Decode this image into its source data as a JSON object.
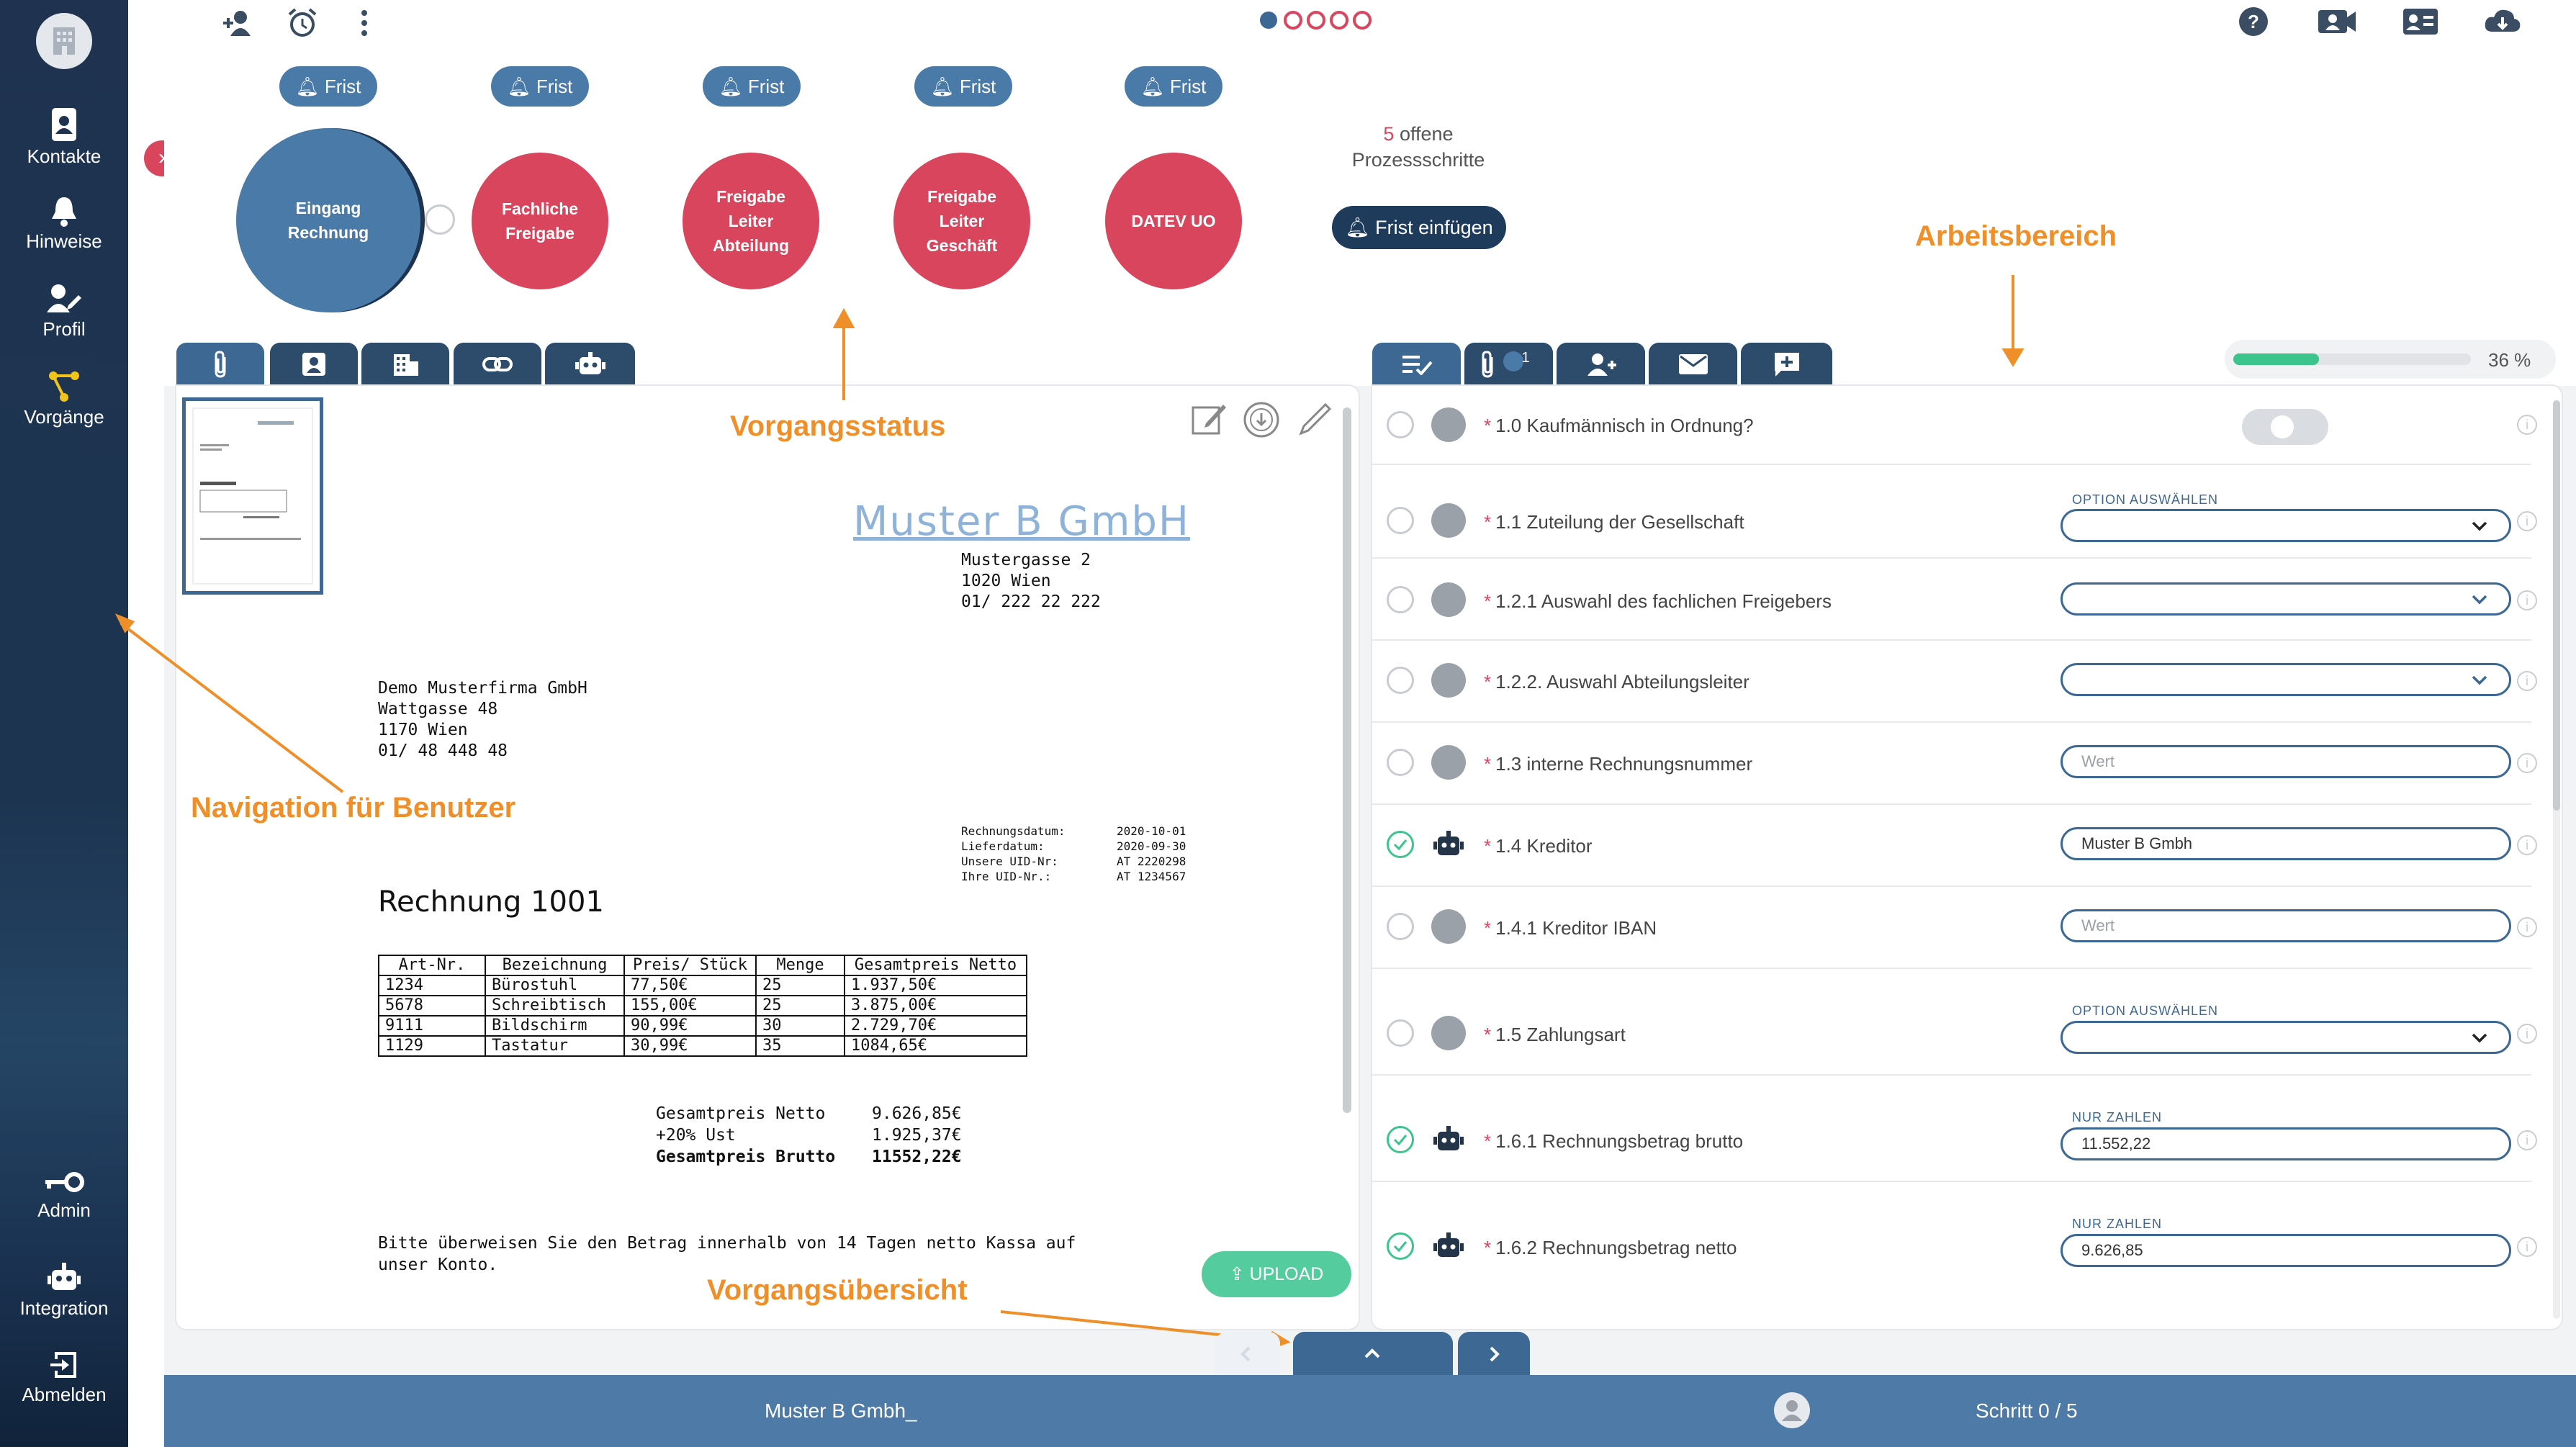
{
  "sidebar": {
    "items": [
      {
        "label": "Kontakte",
        "icon": "contacts-icon"
      },
      {
        "label": "Hinweise",
        "icon": "bell-icon"
      },
      {
        "label": "Profil",
        "icon": "user-edit-icon"
      },
      {
        "label": "Vorgänge",
        "icon": "workflow-icon"
      }
    ],
    "bottom_items": [
      {
        "label": "Admin",
        "icon": "key-icon"
      },
      {
        "label": "Integration",
        "icon": "robot-icon"
      },
      {
        "label": "Abmelden",
        "icon": "logout-icon"
      }
    ]
  },
  "stages": {
    "frist_label": "Frist",
    "items": [
      {
        "label": "Eingang Rechnung",
        "active": true
      },
      {
        "label": "Fachliche Freigabe"
      },
      {
        "label": "Freigabe Leiter Abteilung"
      },
      {
        "label": "Freigabe Leiter Geschäft"
      },
      {
        "label": "DATEV UO"
      }
    ],
    "open_count": "5",
    "open_text": "offene",
    "open_text2": "Prozessschritte",
    "insert_button": "Frist einfügen"
  },
  "annotations": {
    "arbeitsbereich": "Arbeitsbereich",
    "vorgangsstatus": "Vorgangsstatus",
    "navigation": "Navigation für Benutzer",
    "uebersicht": "Vorgangsübersicht"
  },
  "invoice": {
    "company": "Muster B GmbH",
    "address": [
      "Mustergasse 2",
      "1020 Wien",
      "01/ 222 22 222"
    ],
    "recipient": [
      "Demo Musterfirma GmbH",
      "Wattgasse 48",
      "1170 Wien",
      "01/ 48 448 48"
    ],
    "meta_labels": [
      "Rechnungsdatum:",
      "Lieferdatum:",
      "Unsere UID-Nr:",
      "Ihre UID-Nr.:"
    ],
    "meta_values": [
      "2020-10-01",
      "2020-09-30",
      "AT 2220298",
      "AT 1234567"
    ],
    "title": "Rechnung 1001",
    "headers": [
      "Art-Nr.",
      "Bezeichnung",
      "Preis/ Stück",
      "Menge",
      "Gesamtpreis Netto"
    ],
    "rows": [
      [
        "1234",
        "Bürostuhl",
        "77,50€",
        "25",
        "1.937,50€"
      ],
      [
        "5678",
        "Schreibtisch",
        "155,00€",
        "25",
        "3.875,00€"
      ],
      [
        "9111",
        "Bildschirm",
        "90,99€",
        "30",
        "2.729,70€"
      ],
      [
        "1129",
        "Tastatur",
        "30,99€",
        "35",
        "1084,65€"
      ]
    ],
    "totals_labels": [
      "Gesamtpreis Netto",
      "+20% Ust",
      "Gesamtpreis Brutto"
    ],
    "totals_values": [
      "9.626,85€",
      "1.925,37€",
      "11552,22€"
    ],
    "footer": "Bitte überweisen Sie den Betrag innerhalb von 14 Tagen netto Kassa auf unser Konto.",
    "upload": "UPLOAD"
  },
  "workarea": {
    "progress_label": "36 %",
    "progress_value": 0.36,
    "attachment_badge": "1",
    "rows": [
      {
        "q": "1.0 Kaufmännisch in Ordnung?",
        "type": "toggle",
        "done": false,
        "who": "user"
      },
      {
        "q": "1.1 Zuteilung der Gesellschaft",
        "type": "select",
        "label": "OPTION AUSWÄHLEN",
        "done": false,
        "who": "user"
      },
      {
        "q": "1.2.1 Auswahl des fachlichen Freigebers",
        "type": "select",
        "done": false,
        "who": "user"
      },
      {
        "q": "1.2.2. Auswahl Abteilungsleiter",
        "type": "select",
        "done": false,
        "who": "user"
      },
      {
        "q": "1.3 interne Rechnungsnummer",
        "type": "text",
        "placeholder": "Wert",
        "done": false,
        "who": "user"
      },
      {
        "q": "1.4 Kreditor",
        "type": "text",
        "value": "Muster B Gmbh",
        "done": true,
        "who": "bot"
      },
      {
        "q": "1.4.1 Kreditor IBAN",
        "type": "text",
        "placeholder": "Wert",
        "done": false,
        "who": "user"
      },
      {
        "q": "1.5 Zahlungsart",
        "type": "select",
        "label": "OPTION AUSWÄHLEN",
        "done": false,
        "who": "user"
      },
      {
        "q": "1.6.1 Rechnungsbetrag brutto",
        "type": "text",
        "label": "NUR ZAHLEN",
        "value": "11.552,22",
        "done": true,
        "who": "bot"
      },
      {
        "q": "1.6.2 Rechnungsbetrag netto",
        "type": "text",
        "label": "NUR ZAHLEN",
        "value": "9.626,85",
        "done": true,
        "who": "bot"
      }
    ]
  },
  "bottombar": {
    "name": "Muster B Gmbh_",
    "step": "Schritt 0 / 5"
  },
  "colors": {
    "accent": "#3d6894",
    "stage": "#d9455d",
    "sidebar": "#1f3350",
    "annotation": "#ef8f29",
    "ok": "#3cc48d"
  }
}
